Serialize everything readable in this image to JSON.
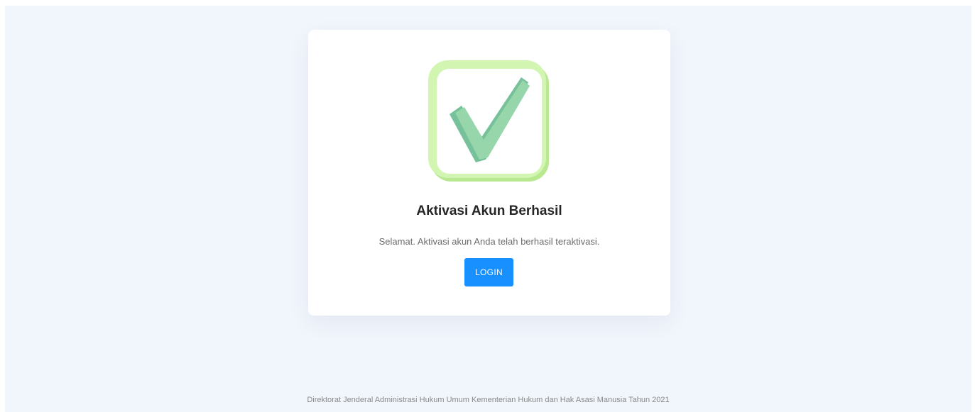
{
  "app": {
    "accent_color": "#1890ff",
    "background_color": "#f1f5fc"
  },
  "card": {
    "icon": "check-square-icon",
    "icon_colors": {
      "frame": "#d2f5b2",
      "frame_shadow": "#b8e890",
      "check": "#96d6aa",
      "check_shadow": "#76c09a"
    },
    "title": "Aktivasi Akun Berhasil",
    "message": "Selamat. Aktivasi akun Anda telah berhasil teraktivasi.",
    "login_label": "LOGIN"
  },
  "footer": {
    "text": "Direktorat Jenderal Administrasi Hukum Umum Kementerian Hukum dan Hak Asasi Manusia Tahun 2021"
  }
}
